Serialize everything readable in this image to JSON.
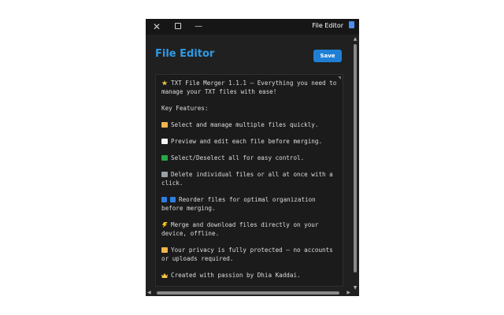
{
  "window": {
    "title": "File Editor",
    "close_glyph": "✕",
    "minimize_glyph": "—",
    "doc_icon": "document-icon"
  },
  "page": {
    "heading": "File Editor",
    "save_label": "Save"
  },
  "editor": {
    "paragraphs": [
      {
        "icon": "sparkles-icon",
        "text": "TXT File Merger 1.1.1 – Everything you need to manage your TXT files with ease!"
      },
      {
        "icon": "",
        "text": "Key Features:"
      },
      {
        "icon": "folder-icon",
        "text": "Select and manage multiple files quickly."
      },
      {
        "icon": "memo-icon",
        "text": "Preview and edit each file before merging."
      },
      {
        "icon": "check-mark-icon",
        "text": "Select/Deselect all for easy control."
      },
      {
        "icon": "wastebasket-icon",
        "text": "Delete individual files or all at once with a click."
      },
      {
        "icon": "up-arrow-icon info-icon",
        "text": "Reorder files for optimal organization before merging."
      },
      {
        "icon": "lightning-icon",
        "text": "Merge and download files directly on your device, offline."
      },
      {
        "icon": "lock-icon",
        "text": "Your privacy is fully protected – no accounts or uploads required."
      },
      {
        "icon": "crown-icon",
        "text": "Created with passion by Dhia Kaddai."
      }
    ]
  },
  "colors": {
    "accent": "#2e9ae6",
    "button": "#1f7fd4",
    "background": "#202020"
  }
}
